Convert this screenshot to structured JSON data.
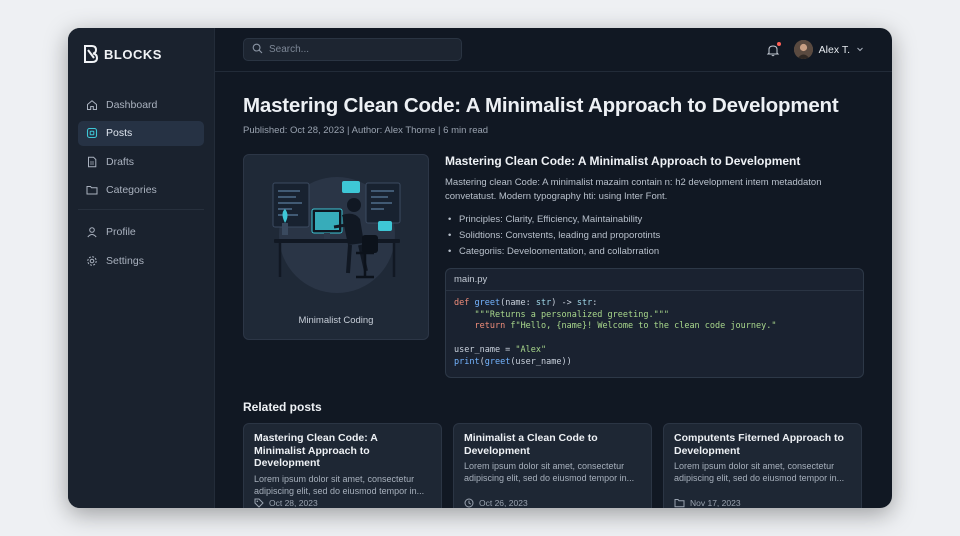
{
  "app": {
    "name": "BLOCKS"
  },
  "sidebar": {
    "items": [
      {
        "label": "Dashboard",
        "icon": "home-icon"
      },
      {
        "label": "Posts",
        "icon": "posts-icon",
        "active": true
      },
      {
        "label": "Drafts",
        "icon": "document-icon"
      },
      {
        "label": "Categories",
        "icon": "folder-icon"
      },
      {
        "label": "Profile",
        "icon": "user-icon"
      },
      {
        "label": "Settings",
        "icon": "gear-icon"
      }
    ]
  },
  "topbar": {
    "search_placeholder": "Search...",
    "user_name": "Alex T.",
    "notification_dot_color": "#ff5f56"
  },
  "post": {
    "title": "Mastering Clean Code: A Minimalist Approach to Development",
    "meta": "Published: Oct 28, 2023 | Author: Alex Thorne | 6 min read",
    "image_caption": "Minimalist Coding",
    "heading": "Mastering Clean Code: A Minimalist Approach to Development",
    "intro": "Mastering clean Code: A minimalist mazaim contain n: h2 development intem metaddaton convetatust. Modern typography  hti: using Inter Font.",
    "bullets": [
      "Principles: Clarity, Efficiency, Maintainability",
      "Solidtions: Convstents, leading and proporotints",
      "Categoriis: Develoomentation, and collabrration"
    ],
    "code": {
      "filename": "main.py",
      "lines": [
        "def greet(name: str) -> str:",
        "    \"\"\"Returns a personalized greeting.\"\"\"",
        "    return f\"Hello, {name}! Welcome to the clean code journey.\"",
        "",
        "user_name = \"Alex\"",
        "print(greet(user_name))"
      ]
    }
  },
  "related": {
    "title": "Related posts",
    "cards": [
      {
        "title": "Mastering Clean Code: A Minimalist Approach to Development",
        "excerpt": "Lorem ipsum dolor sit amet, consectetur adipiscing elit, sed do eiusmod tempor in...",
        "date": "Oct 28, 2023",
        "icon": "tag-icon"
      },
      {
        "title": "Minimalist a Clean Code to Development",
        "excerpt": "Lorem ipsum dolor sit amet, consectetur adipiscing elit, sed do eiusmod tempor in...",
        "date": "Oct 26, 2023",
        "icon": "clock-icon"
      },
      {
        "title": "Computents Fiterned Approach to Development",
        "excerpt": "Lorem ipsum dolor sit amet, consectetur adipiscing elit, sed do eiusmod tempor in...",
        "date": "Nov 17, 2023",
        "icon": "folder-icon"
      }
    ]
  }
}
